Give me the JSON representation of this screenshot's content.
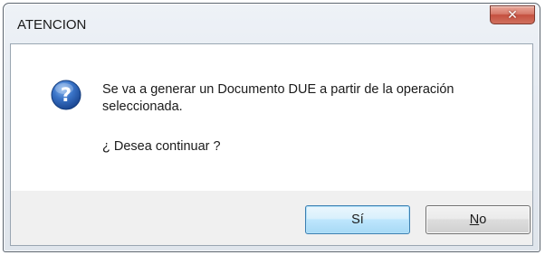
{
  "window": {
    "title": "ATENCION",
    "close_icon": "close-icon"
  },
  "dialog": {
    "icon": "question-icon",
    "message_line1": "Se va a generar un Documento DUE a partir de la operación",
    "message_line2": "seleccionada.",
    "question": "¿ Desea continuar ?"
  },
  "buttons": {
    "yes_label": "Sí",
    "no_label_underlined": "N",
    "no_label_rest": "o"
  },
  "colors": {
    "default_button_border": "#3c7fb1",
    "close_button": "#c5503f",
    "icon_blue": "#2a5fb0"
  }
}
